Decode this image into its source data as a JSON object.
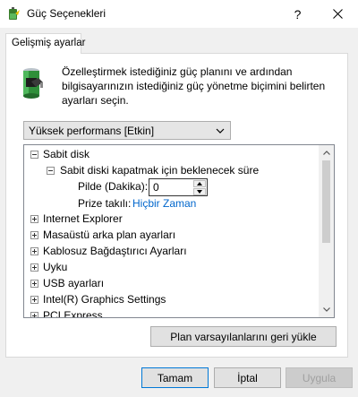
{
  "window": {
    "title": "Güç Seçenekleri",
    "help_glyph": "?",
    "close_icon": "close-icon"
  },
  "tab": {
    "label": "Gelişmiş ayarlar"
  },
  "description": "Özelleştirmek istediğiniz güç planını ve ardından bilgisayarınızın istediğiniz güç yönetme biçimini belirten ayarları seçin.",
  "plan_select": {
    "selected": "Yüksek performans [Etkin]"
  },
  "tree": {
    "sabit_disk": "Sabit disk",
    "turn_off": "Sabit diski kapatmak için beklenecek süre",
    "battery_label": "Pilde (Dakika):",
    "battery_value": "0",
    "plugged_label": "Prize takılı:",
    "plugged_value": "Hiçbir Zaman",
    "items": [
      "Internet Explorer",
      "Masaüstü arka plan ayarları",
      "Kablosuz Bağdaştırıcı Ayarları",
      "Uyku",
      "USB ayarları",
      "Intel(R) Graphics Settings",
      "PCI Express"
    ]
  },
  "buttons": {
    "restore_defaults": "Plan varsayılanlarını geri yükle",
    "ok": "Tamam",
    "cancel": "İptal",
    "apply": "Uygula"
  },
  "colors": {
    "link": "#0066cc",
    "primary_border": "#0078d7"
  }
}
